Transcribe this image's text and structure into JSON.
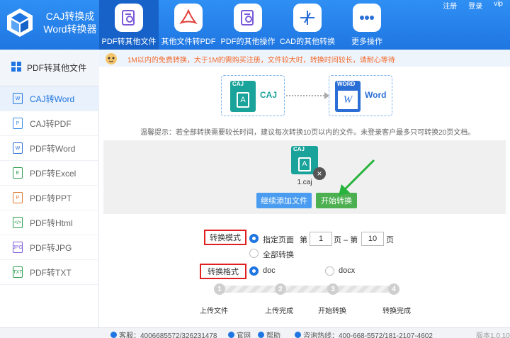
{
  "app": {
    "title_line1": "CAJ转换成",
    "title_line2": "Word转换器"
  },
  "nav": {
    "tabs": [
      {
        "label": "PDF转其他文件",
        "icon": "gear-doc-icon"
      },
      {
        "label": "其他文件转PDF",
        "icon": "pdf-icon"
      },
      {
        "label": "PDF的其他操作",
        "icon": "gear-doc-icon"
      },
      {
        "label": "CAD的其他转换",
        "icon": "cad-icon"
      },
      {
        "label": "更多操作",
        "icon": "more-icon"
      }
    ],
    "links": {
      "register": "注册",
      "login": "登录",
      "vip": "vip"
    }
  },
  "notice": {
    "text": "1M以内的免费转换，大于1M的需购买注册，文件较大时，转换时间较长，请耐心等待"
  },
  "sidebar": {
    "header": "PDF转其他文件",
    "items": [
      {
        "label": "CAJ转Word",
        "tag": "W"
      },
      {
        "label": "CAJ转PDF",
        "tag": "P"
      },
      {
        "label": "PDF转Word",
        "tag": "W"
      },
      {
        "label": "PDF转Excel",
        "tag": "E"
      },
      {
        "label": "PDF转PPT",
        "tag": "P"
      },
      {
        "label": "PDF转Html",
        "tag": "</>"
      },
      {
        "label": "PDF转JPG",
        "tag": "JPG"
      },
      {
        "label": "PDF转TXT",
        "tag": "TXT"
      }
    ]
  },
  "flow": {
    "source_tag": "CAJ",
    "source_label": "CAJ",
    "target_tag": "WORD",
    "target_label": "Word",
    "source_glyph": "A",
    "target_glyph": "W"
  },
  "tip": "温馨提示：若全部转换需要较长时间，建议每次转换10页以内的文件。未登录客户最多只可转换20页文档。",
  "file": {
    "tag": "CAJ",
    "glyph": "A",
    "name": "1.caj"
  },
  "buttons": {
    "add_more": "继续添加文件",
    "start": "开始转换"
  },
  "mode": {
    "label": "转换模式",
    "specific_pages": "指定页面",
    "prefix": "第",
    "from_page": "1",
    "mid": "页 – 第",
    "to_page": "10",
    "suffix": "页",
    "all_pages": "全部转换"
  },
  "format": {
    "label": "转换格式",
    "doc": "doc",
    "docx": "docx"
  },
  "steps": [
    {
      "num": "1",
      "label": "上传文件"
    },
    {
      "num": "2",
      "label": "上传完成"
    },
    {
      "num": "3",
      "label": "开始转换"
    },
    {
      "num": "4",
      "label": "转换完成"
    }
  ],
  "footer": {
    "qq": "客服：4006685572/326231478",
    "site": "官网",
    "help": "帮助",
    "hotline": "咨询热线：400-668-5572/181-2107-4602",
    "version": "版本1.0.10"
  },
  "colors": {
    "brand": "#1f76e2",
    "caj_green": "#1aa39a",
    "word_blue": "#2b6fd6",
    "start_green": "#4caf50",
    "add_blue": "#4a9cf0"
  }
}
